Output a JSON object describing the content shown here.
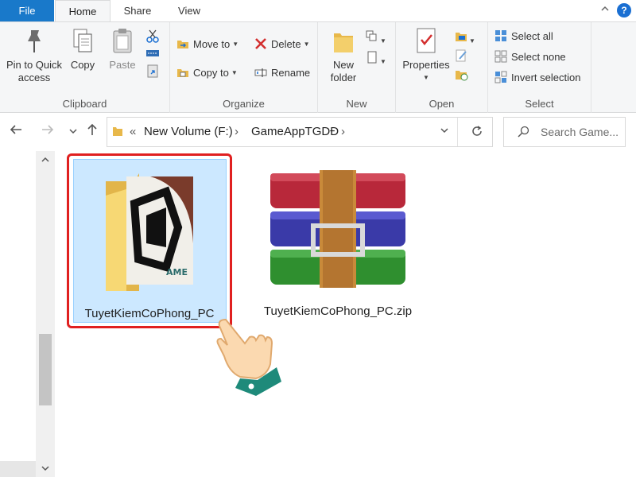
{
  "tabs": {
    "file": "File",
    "home": "Home",
    "share": "Share",
    "view": "View"
  },
  "ribbon": {
    "clipboard": {
      "label": "Clipboard",
      "pin_line1": "Pin to Quick",
      "pin_line2": "access",
      "copy": "Copy",
      "paste": "Paste"
    },
    "organize": {
      "label": "Organize",
      "move_to": "Move to",
      "copy_to": "Copy to",
      "delete": "Delete",
      "rename": "Rename"
    },
    "new": {
      "label": "New",
      "new_folder_line1": "New",
      "new_folder_line2": "folder"
    },
    "open": {
      "label": "Open",
      "properties": "Properties"
    },
    "select": {
      "label": "Select",
      "select_all": "Select all",
      "select_none": "Select none",
      "invert": "Invert selection"
    }
  },
  "address": {
    "separator": "«",
    "crumbs": [
      "New Volume (F:)",
      "GameAppTGDĐ"
    ],
    "search_placeholder": "Search Game..."
  },
  "files": [
    {
      "name": "TuyetKiemCoPhong_PC",
      "type": "folder",
      "selected": true
    },
    {
      "name": "TuyetKiemCoPhong_PC.zip",
      "type": "zip",
      "selected": false
    }
  ],
  "icons": {
    "pin": "pin-icon",
    "copy": "copy-icon",
    "paste": "paste-icon",
    "cut": "scissors-icon",
    "move_to": "move-to-icon",
    "copy_to": "copy-to-icon",
    "delete": "delete-x-icon",
    "rename": "rename-icon",
    "new_folder": "new-folder-icon",
    "properties": "properties-icon",
    "select_all": "select-all-icon",
    "select_none": "select-none-icon",
    "invert": "invert-selection-icon",
    "search": "search-icon",
    "refresh": "refresh-icon",
    "hand": "pointing-hand-icon"
  },
  "colors": {
    "accent": "#1979ca",
    "selection": "#cce8ff",
    "highlight_border": "#e02020",
    "delete_red": "#d32f2f"
  }
}
